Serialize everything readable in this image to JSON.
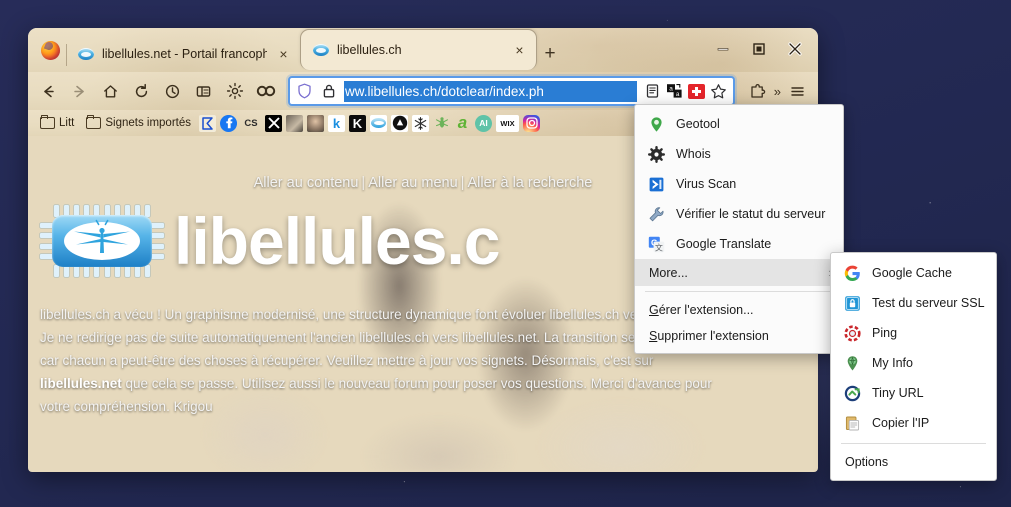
{
  "window": {
    "controls": {
      "minimize": "minimize-icon",
      "maximize": "maximize-icon",
      "close": "close-icon"
    }
  },
  "tabs": [
    {
      "title": "libellules.net - Portail francophe",
      "favicon": "dragonfly-favicon",
      "active": false,
      "close_label": "×"
    },
    {
      "title": "libellules.ch",
      "favicon": "dragonfly-favicon",
      "active": true,
      "close_label": "×"
    }
  ],
  "newtab_label": "+",
  "toolbar": {
    "back": "back-arrow-icon",
    "forward": "forward-arrow-icon",
    "home": "home-icon",
    "reload": "reload-icon",
    "history": "clock-icon",
    "sidebar": "sidebar-icon",
    "settings": "gear-icon",
    "extension_link": "link-chain-icon",
    "overflow_label": "»",
    "menu_label": "☰"
  },
  "urlbar": {
    "shield_icon": "shield-icon",
    "lock_icon": "padlock-icon",
    "value": "ww.libellules.ch/dotclear/index.ph",
    "full_value": "https://www.libellules.ch/dotclear/index.php",
    "selected": true,
    "reader_icon": "reader-mode-icon",
    "translate_icon": "translate-icon",
    "extension_icon": "swiss-flag-extension-icon",
    "bookmark_icon": "star-icon",
    "accent": "#2a7dd4",
    "border": "#5a9ae8"
  },
  "bookmarks": [
    {
      "label": "Litt",
      "type": "folder"
    },
    {
      "label": "Signets importés",
      "type": "folder"
    },
    {
      "label": "",
      "type": "icon",
      "icon": "sigma-icon",
      "color": "#1a4fd0",
      "bg": "#f0ead8"
    },
    {
      "label": "",
      "type": "icon",
      "icon": "facebook-icon",
      "color": "#ffffff",
      "bg": "#1877f2"
    },
    {
      "label": "CS",
      "type": "text",
      "color": "#2b2b2b",
      "bg": "transparent"
    },
    {
      "label": "",
      "type": "icon",
      "icon": "x-twitter-icon",
      "color": "#ffffff",
      "bg": "#000000"
    },
    {
      "label": "",
      "type": "icon",
      "icon": "photo-thumb-icon",
      "color": "#c9bda8",
      "bg": "#6b6258"
    },
    {
      "label": "",
      "type": "icon",
      "icon": "portrait-thumb-icon",
      "color": "#d8c0a8",
      "bg": "#7a6a58"
    },
    {
      "label": "k",
      "type": "text",
      "color": "#1a8fe0",
      "bg": "#ffffff"
    },
    {
      "label": "K",
      "type": "text",
      "color": "#ffffff",
      "bg": "#0b0b0b"
    },
    {
      "label": "",
      "type": "icon",
      "icon": "dragonfly-site-icon",
      "color": "#2a9fdc",
      "bg": "#ffffff"
    },
    {
      "label": "",
      "type": "icon",
      "icon": "drive-circle-icon",
      "color": "#ffffff",
      "bg": "#111111"
    },
    {
      "label": "",
      "type": "icon",
      "icon": "snowflake-icon",
      "color": "#333333",
      "bg": "#ffffff"
    },
    {
      "label": "",
      "type": "icon",
      "icon": "green-bug-icon",
      "color": "#5aa84a",
      "bg": "transparent"
    },
    {
      "label": "a",
      "type": "text",
      "color": "#5fb335",
      "bg": "transparent"
    },
    {
      "label": "AI",
      "type": "text",
      "color": "#ffffff",
      "bg": "#5fc3a8"
    },
    {
      "label": "WIX",
      "type": "text",
      "color": "#111111",
      "bg": "#ffffff"
    },
    {
      "label": "",
      "type": "icon",
      "icon": "instagram-icon",
      "color": "#ffffff",
      "bg": "#d62976"
    }
  ],
  "page": {
    "skiplinks": [
      "Aller au contenu",
      "Aller au menu",
      "Aller à la recherche"
    ],
    "separator": "|",
    "logo": "dragonfly-chip-logo",
    "title": "libellules.c",
    "paragraph_lines": [
      "libellules.ch a vécu ! Un graphisme modernisé, une structure dynamique font évoluer libellules.ch vers libellules.net.",
      "Je ne redirige pas de suite automatiquement l'ancien libellules.ch vers libellules.net. La transition se fait en douceur,",
      "car chacun a peut-être des choses à récupérer. Veuillez mettre à jour vos signets. Désormais, c'est sur"
    ],
    "paragraph_bold": "libellules.net",
    "paragraph_after_bold": " que cela se passe. Utilisez aussi le nouveau forum pour poser vos questions. Merci d'avance pour",
    "paragraph_last": "votre compréhension. Krigou"
  },
  "context_menu": {
    "items": [
      {
        "label": "Geotool",
        "icon": "map-pin-icon"
      },
      {
        "label": "Whois",
        "icon": "gear-dark-icon"
      },
      {
        "label": "Virus Scan",
        "icon": "blue-arrow-icon"
      },
      {
        "label": "Vérifier le statut du serveur",
        "icon": "wrench-icon"
      },
      {
        "label": "Google Translate",
        "icon": "google-translate-icon"
      },
      {
        "label": "More...",
        "icon": "none",
        "submenu": true,
        "highlighted": true,
        "arrow": "›"
      }
    ],
    "footer_items": [
      {
        "label": "Gérer l'extension...",
        "accesskey": "G"
      },
      {
        "label": "Supprimer l'extension",
        "accesskey": "S"
      }
    ]
  },
  "submenu": {
    "items": [
      {
        "label": "Google Cache",
        "icon": "google-g-icon"
      },
      {
        "label": "Test du serveur SSL",
        "icon": "ssl-lock-icon"
      },
      {
        "label": "Ping",
        "icon": "ping-icon"
      },
      {
        "label": "My Info",
        "icon": "globe-pin-icon"
      },
      {
        "label": "Tiny URL",
        "icon": "tiny-url-icon"
      },
      {
        "label": "Copier l'IP",
        "icon": "clipboard-icon"
      }
    ],
    "options_label": "Options"
  }
}
